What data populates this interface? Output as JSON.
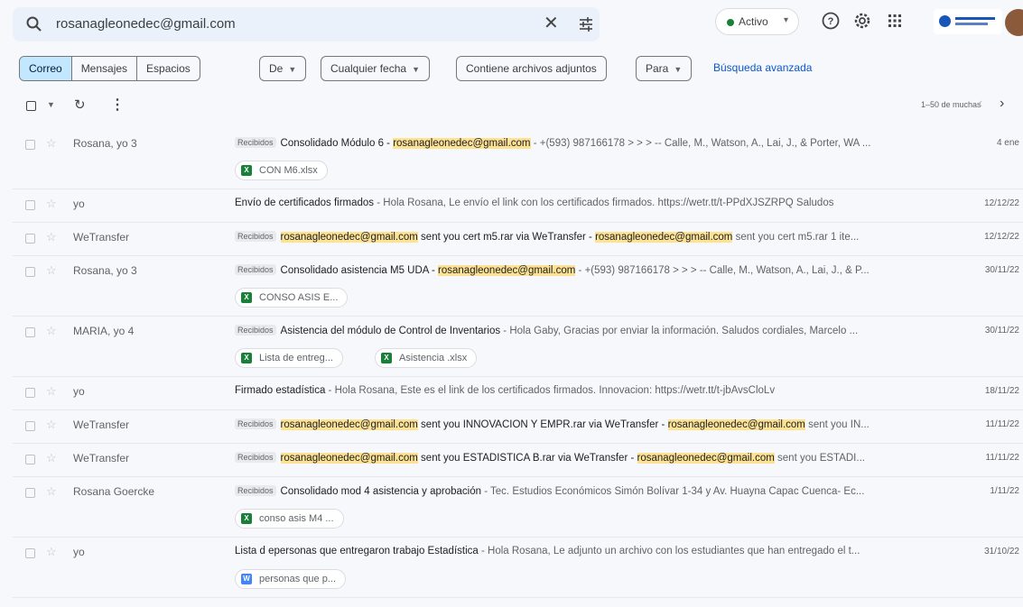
{
  "search": {
    "query": "rosanagleonedec@gmail.com"
  },
  "header": {
    "status": "Activo"
  },
  "filters": {
    "tabs": [
      {
        "label": "Correo"
      },
      {
        "label": "Mensajes"
      },
      {
        "label": "Espacios"
      }
    ],
    "chips": [
      {
        "label": "De"
      },
      {
        "label": "Cualquier fecha"
      },
      {
        "label": "Contiene archivos adjuntos"
      },
      {
        "label": "Para"
      }
    ],
    "advanced": "Búsqueda avanzada"
  },
  "toolbar": {
    "pager": "1–50 de muchas"
  },
  "label_text": "Recibidos",
  "emails": [
    {
      "sender": "Rosana, yo 3",
      "subject": "Consolidado Módulo 6 - ",
      "subject_hl": "rosanagleonedec@gmail.com",
      "snippet": " - +(593) 987166178 > > > -- Calle, M., Watson, A., Lai, J., & Porter, WA ...",
      "date": "4 ene",
      "attachments": [
        {
          "name": "CON M6.xlsx",
          "type": "xls"
        }
      ]
    },
    {
      "sender": "yo",
      "subject": "Envío de certificados firmados",
      "snippet": " - Hola Rosana, Le envío el link con los certificados firmados. https://wetr.tt/t-PPdXJSZRPQ Saludos",
      "date": "12/12/22",
      "attachments": []
    },
    {
      "sender": "WeTransfer",
      "subject_hl": "rosanagleonedec@gmail.com",
      "subject": " sent you cert m5.rar via WeTransfer - ",
      "snippet_hl": "rosanagleonedec@gmail.com",
      "snippet": " sent you cert m5.rar 1 ite...",
      "date": "12/12/22",
      "attachments": []
    },
    {
      "sender": "Rosana, yo 3",
      "subject": "Consolidado asistencia M5 UDA - ",
      "subject_hl": "rosanagleonedec@gmail.com",
      "snippet": " - +(593) 987166178 > > > -- Calle, M., Watson, A., Lai, J., & P...",
      "date": "30/11/22",
      "attachments": [
        {
          "name": "CONSO ASIS E...",
          "type": "xls"
        }
      ]
    },
    {
      "sender": "MARIA, yo 4",
      "subject": "Asistencia del módulo de Control de Inventarios",
      "snippet": " - Hola Gaby, Gracias por enviar la información. Saludos cordiales, Marcelo ...",
      "date": "30/11/22",
      "attachments": [
        {
          "name": "Lista de entreg...",
          "type": "xls"
        },
        {
          "name": "Asistencia .xlsx",
          "type": "xls"
        }
      ]
    },
    {
      "sender": "yo",
      "subject": "Firmado estadística",
      "snippet": " - Hola Rosana, Este es el link de los certificados firmados. Innovacion: https://wetr.tt/t-jbAvsCloLv",
      "date": "18/11/22",
      "attachments": []
    },
    {
      "sender": "WeTransfer",
      "subject_hl": "rosanagleonedec@gmail.com",
      "subject": " sent you INNOVACION Y EMPR.rar via WeTransfer - ",
      "snippet_hl": "rosanagleonedec@gmail.com",
      "snippet": " sent you IN...",
      "date": "11/11/22",
      "attachments": []
    },
    {
      "sender": "WeTransfer",
      "subject_hl": "rosanagleonedec@gmail.com",
      "subject": " sent you ESTADISTICA B.rar via WeTransfer - ",
      "snippet_hl": "rosanagleonedec@gmail.com",
      "snippet": " sent you ESTADI...",
      "date": "11/11/22",
      "attachments": []
    },
    {
      "sender": "Rosana Goercke",
      "subject": "Consolidado mod 4 asistencia y aprobación",
      "snippet": " - Tec. Estudios Económicos Simón Bolívar 1-34 y Av. Huayna Capac Cuenca- Ec...",
      "date": "1/11/22",
      "attachments": [
        {
          "name": "conso asis M4 ...",
          "type": "xls"
        }
      ]
    },
    {
      "sender": "yo",
      "subject": "Lista d epersonas que entregaron trabajo Estadística",
      "snippet": " - Hola Rosana, Le adjunto un archivo con los estudiantes que han entregado el t...",
      "date": "31/10/22",
      "attachments": [
        {
          "name": "personas que p...",
          "type": "doc"
        }
      ]
    }
  ]
}
